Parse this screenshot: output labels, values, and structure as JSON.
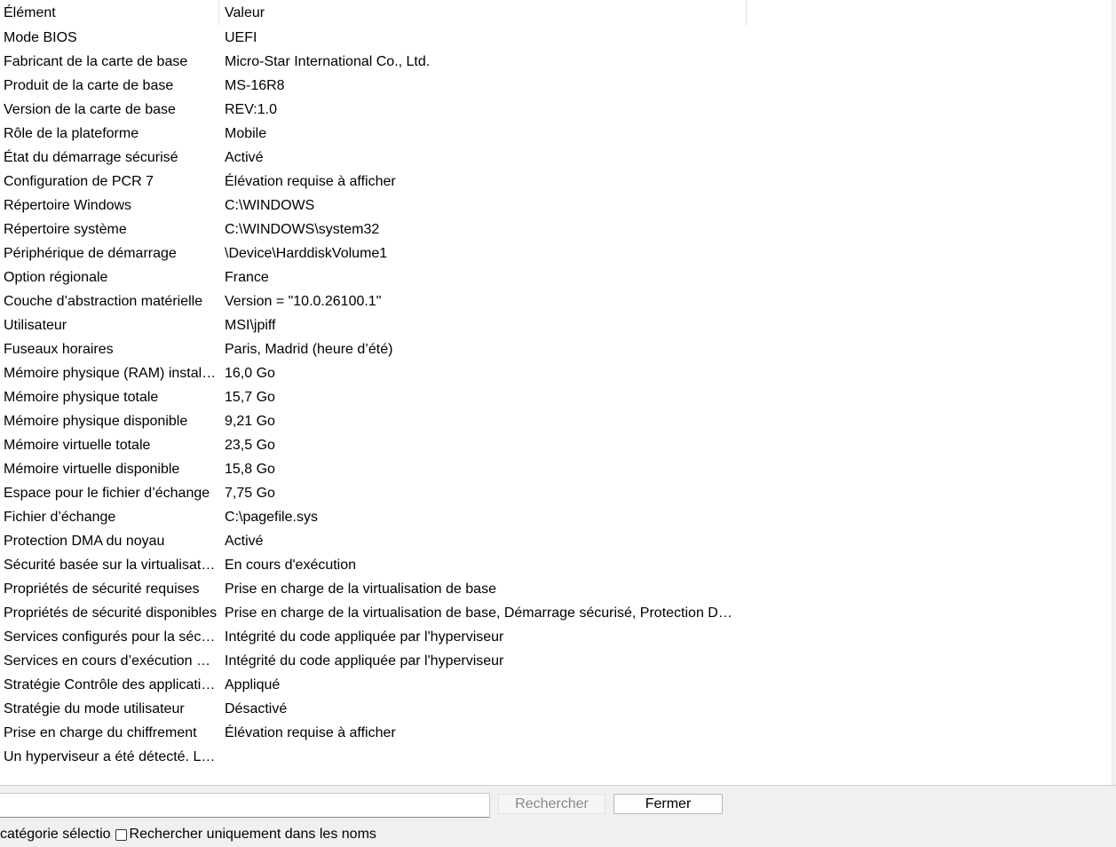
{
  "table": {
    "headers": {
      "item": "Élément",
      "value": "Valeur"
    },
    "rows": [
      {
        "item": "Mode BIOS",
        "value": "UEFI"
      },
      {
        "item": "Fabricant de la carte de base",
        "value": "Micro-Star International Co., Ltd."
      },
      {
        "item": "Produit de la carte de base",
        "value": "MS-16R8"
      },
      {
        "item": "Version de la carte de base",
        "value": "REV:1.0"
      },
      {
        "item": "Rôle de la plateforme",
        "value": "Mobile"
      },
      {
        "item": "État du démarrage sécurisé",
        "value": "Activé"
      },
      {
        "item": "Configuration de PCR 7",
        "value": "Élévation requise à afficher"
      },
      {
        "item": "Répertoire Windows",
        "value": "C:\\WINDOWS"
      },
      {
        "item": "Répertoire système",
        "value": "C:\\WINDOWS\\system32"
      },
      {
        "item": "Périphérique de démarrage",
        "value": "\\Device\\HarddiskVolume1"
      },
      {
        "item": "Option régionale",
        "value": "France"
      },
      {
        "item": "Couche d’abstraction matérielle",
        "value": "Version = \"10.0.26100.1\""
      },
      {
        "item": "Utilisateur",
        "value": "MSI\\jpiff"
      },
      {
        "item": "Fuseaux horaires",
        "value": "Paris, Madrid (heure d’été)"
      },
      {
        "item": "Mémoire physique (RAM) installée",
        "value": "16,0 Go"
      },
      {
        "item": "Mémoire physique totale",
        "value": "15,7 Go"
      },
      {
        "item": "Mémoire physique disponible",
        "value": "9,21 Go"
      },
      {
        "item": "Mémoire virtuelle totale",
        "value": "23,5 Go"
      },
      {
        "item": "Mémoire virtuelle disponible",
        "value": "15,8 Go"
      },
      {
        "item": "Espace pour le fichier d’échange",
        "value": "7,75 Go"
      },
      {
        "item": "Fichier d’échange",
        "value": "C:\\pagefile.sys"
      },
      {
        "item": "Protection DMA du noyau",
        "value": "Activé"
      },
      {
        "item": "Sécurité basée sur la virtualisation",
        "value": "En cours d'exécution"
      },
      {
        "item": "Propriétés de sécurité requises",
        "value": "Prise en charge de la virtualisation de base"
      },
      {
        "item": "Propriétés de sécurité disponibles",
        "value": "Prise en charge de la virtualisation de base, Démarrage sécurisé, Protection DMA"
      },
      {
        "item": "Services configurés pour la sécurité",
        "value": "Intégrité du code appliquée par l'hyperviseur"
      },
      {
        "item": "Services en cours d’exécution pour la sécurité",
        "value": "Intégrité du code appliquée par l'hyperviseur"
      },
      {
        "item": "Stratégie Contrôle des applications",
        "value": "Appliqué"
      },
      {
        "item": "Stratégie du mode utilisateur",
        "value": "Désactivé"
      },
      {
        "item": "Prise en charge du chiffrement",
        "value": "Élévation requise à afficher"
      },
      {
        "item": "Un hyperviseur a été détecté. Les fonctionnalités",
        "value": ""
      }
    ]
  },
  "search": {
    "value": "",
    "placeholder": "",
    "search_button": "Rechercher",
    "close_button": "Fermer",
    "category_label": "catégorie sélectio",
    "names_only_label": "Rechercher uniquement dans les noms",
    "names_only_checked": false
  }
}
